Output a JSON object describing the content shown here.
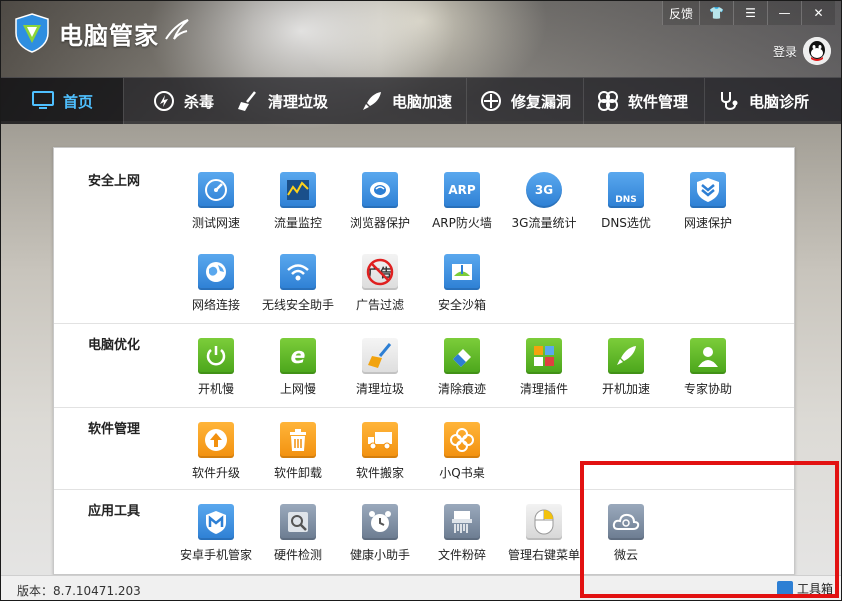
{
  "app": {
    "title": "电脑管家",
    "login": "登录"
  },
  "titlebar": {
    "feedback": "反馈"
  },
  "nav": [
    {
      "label": "首页",
      "icon": "monitor-icon"
    },
    {
      "label": "杀毒",
      "icon": "virus-scan-icon"
    },
    {
      "label": "清理垃圾",
      "icon": "broom-icon"
    },
    {
      "label": "电脑加速",
      "icon": "rocket-icon"
    },
    {
      "label": "修复漏洞",
      "icon": "patch-icon"
    },
    {
      "label": "软件管理",
      "icon": "software-icon"
    },
    {
      "label": "电脑诊所",
      "icon": "stethoscope-icon"
    }
  ],
  "sections": [
    {
      "title": "安全上网",
      "tools": [
        {
          "label": "测试网速",
          "icon": "speedometer-icon"
        },
        {
          "label": "流量监控",
          "icon": "traffic-chart-icon"
        },
        {
          "label": "浏览器保护",
          "icon": "browser-shield-icon"
        },
        {
          "label": "ARP防火墙",
          "icon": "arp-firewall-icon",
          "text": "ARP"
        },
        {
          "label": "3G流量统计",
          "icon": "3g-icon",
          "text": "3G"
        },
        {
          "label": "DNS选优",
          "icon": "dns-icon",
          "text": "DNS"
        },
        {
          "label": "网速保护",
          "icon": "shield-chevron-icon"
        },
        {
          "label": "网络连接",
          "icon": "globe-icon"
        },
        {
          "label": "无线安全助手",
          "icon": "wifi-icon"
        },
        {
          "label": "广告过滤",
          "icon": "ad-block-icon",
          "text": "广告"
        },
        {
          "label": "安全沙箱",
          "icon": "sandbox-icon"
        }
      ]
    },
    {
      "title": "电脑优化",
      "tools": [
        {
          "label": "开机慢",
          "icon": "power-icon"
        },
        {
          "label": "上网慢",
          "icon": "ie-icon"
        },
        {
          "label": "清理垃圾",
          "icon": "brush-icon"
        },
        {
          "label": "清除痕迹",
          "icon": "eraser-icon"
        },
        {
          "label": "清理插件",
          "icon": "puzzle-icon"
        },
        {
          "label": "开机加速",
          "icon": "rocket-icon"
        },
        {
          "label": "专家协助",
          "icon": "expert-icon"
        }
      ]
    },
    {
      "title": "软件管理",
      "tools": [
        {
          "label": "软件升级",
          "icon": "upgrade-arrow-icon"
        },
        {
          "label": "软件卸载",
          "icon": "trash-icon"
        },
        {
          "label": "软件搬家",
          "icon": "truck-icon"
        },
        {
          "label": "小Q书桌",
          "icon": "clover-icon"
        }
      ]
    },
    {
      "title": "应用工具",
      "tools": [
        {
          "label": "安卓手机管家",
          "icon": "android-manager-icon"
        },
        {
          "label": "硬件检测",
          "icon": "hardware-scan-icon"
        },
        {
          "label": "健康小助手",
          "icon": "alarm-clock-icon"
        },
        {
          "label": "文件粉碎",
          "icon": "shredder-icon"
        },
        {
          "label": "管理右键菜单",
          "icon": "mouse-icon"
        },
        {
          "label": "微云",
          "icon": "cloud-icon"
        }
      ]
    }
  ],
  "footer": {
    "version": "版本：8.7.10471.203",
    "toolbox": "工具箱"
  },
  "colors": {
    "highlight": "#e21111",
    "nav_active": "#4fc0ff"
  }
}
